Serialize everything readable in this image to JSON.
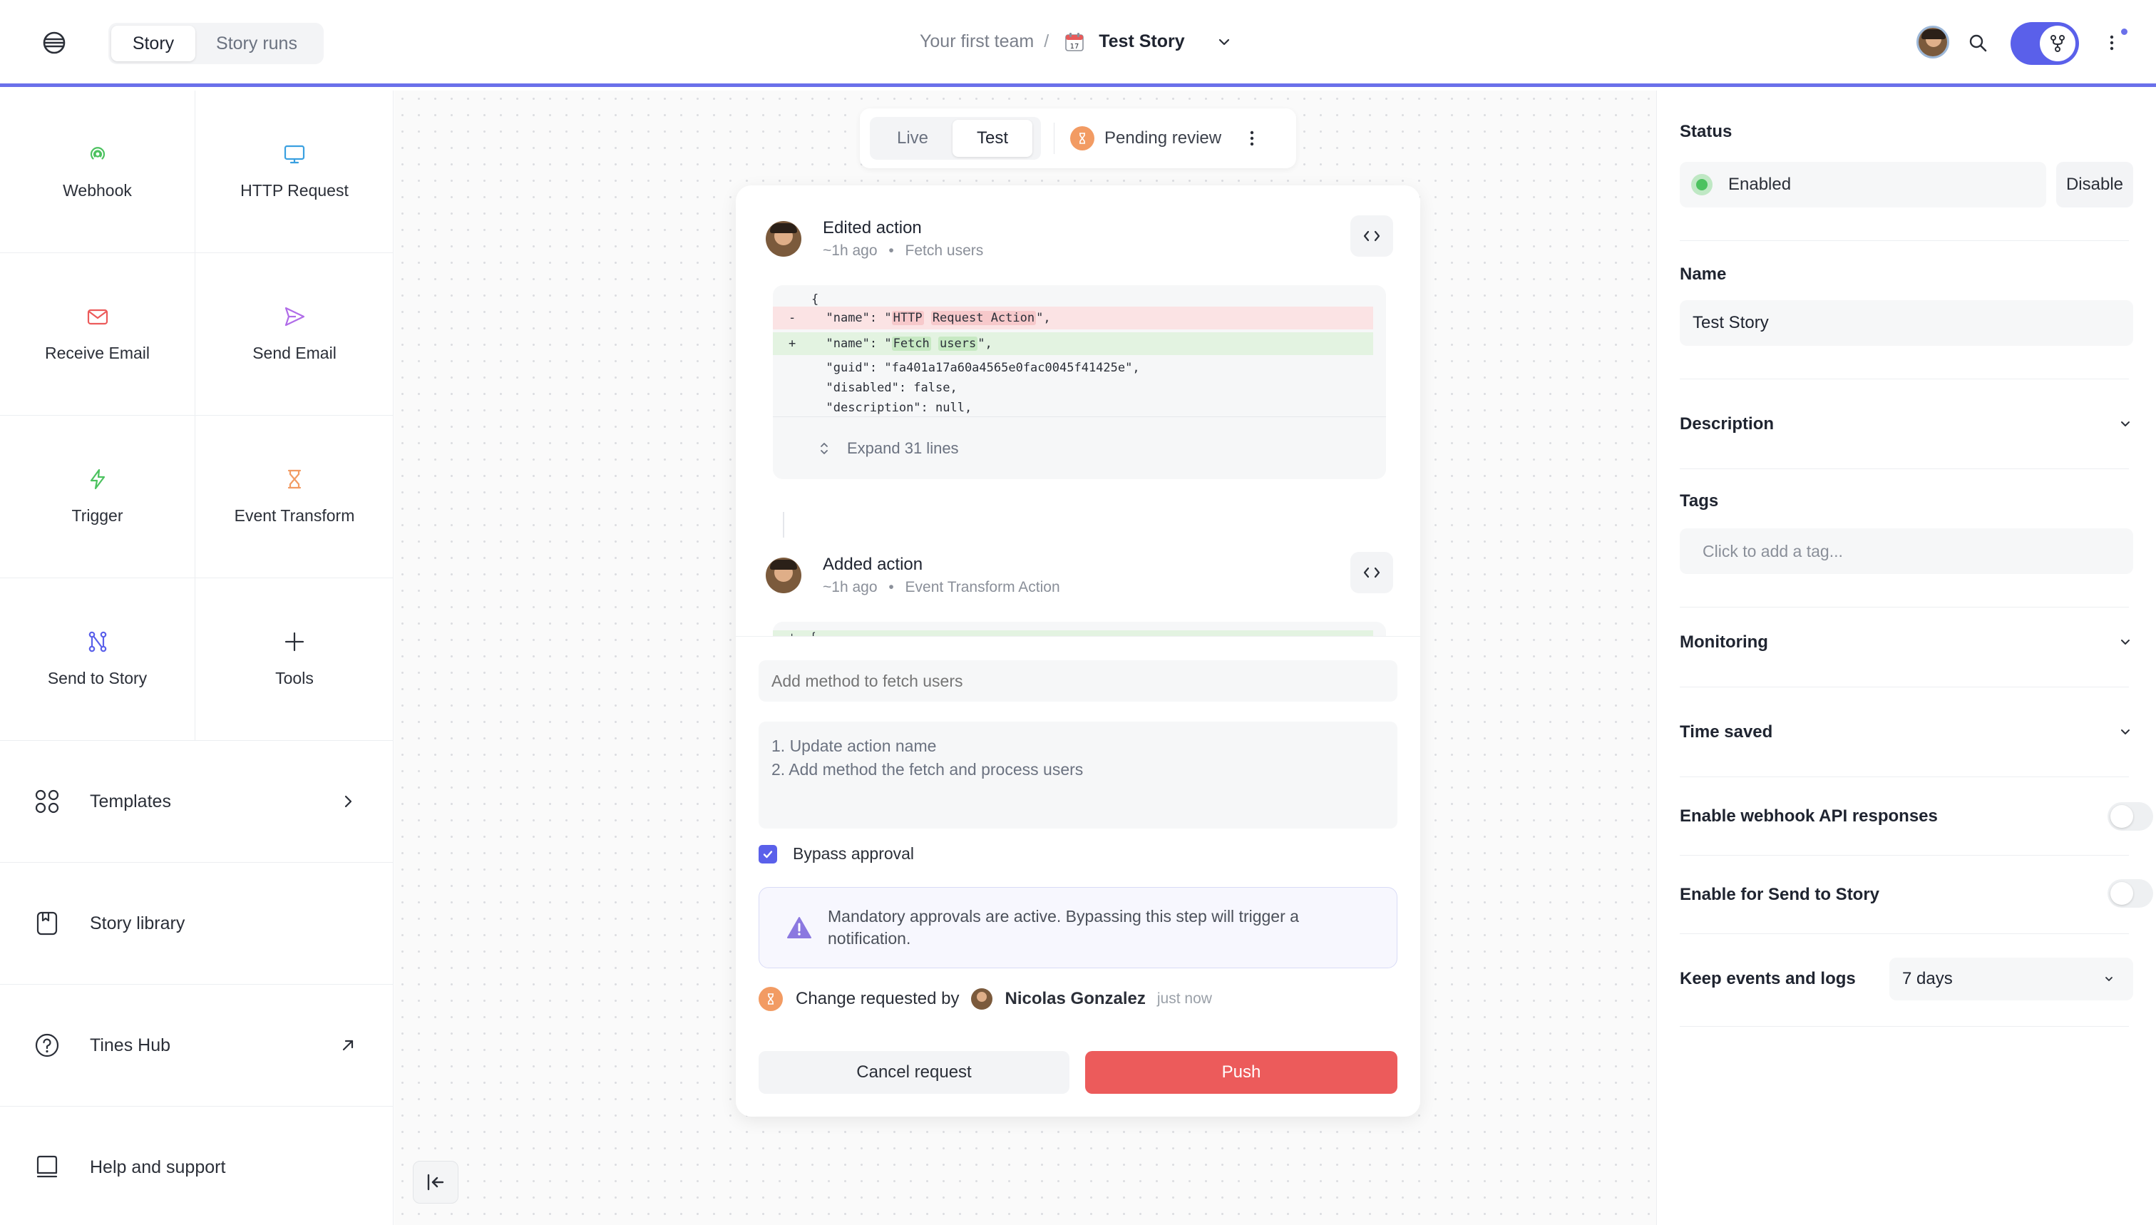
{
  "header": {
    "tabs": [
      {
        "label": "Story",
        "active": true
      },
      {
        "label": "Story runs",
        "active": false
      }
    ],
    "breadcrumb": {
      "team": "Your first team",
      "separator": "/",
      "story": "Test Story"
    },
    "accent_color": "#5a60ea"
  },
  "sidebar": {
    "tools": [
      {
        "label": "Webhook",
        "icon": "webhook-icon",
        "color": "#4cc25f"
      },
      {
        "label": "HTTP Request",
        "icon": "monitor-icon",
        "color": "#3aa0e0"
      },
      {
        "label": "Receive Email",
        "icon": "mail-icon",
        "color": "#ec5b5b"
      },
      {
        "label": "Send Email",
        "icon": "send-icon",
        "color": "#b06ce8"
      },
      {
        "label": "Trigger",
        "icon": "bolt-icon",
        "color": "#4cc25f"
      },
      {
        "label": "Event Transform",
        "icon": "hourglass-icon",
        "color": "#f29b63"
      },
      {
        "label": "Send to Story",
        "icon": "branch-icon",
        "color": "#5a60ea"
      },
      {
        "label": "Tools",
        "icon": "plus-icon",
        "color": "#2b2f38"
      }
    ],
    "nav": [
      {
        "label": "Templates",
        "icon": "grid-icon",
        "trail": "chevron-right-icon"
      },
      {
        "label": "Story library",
        "icon": "book-icon",
        "trail": ""
      },
      {
        "label": "Tines Hub",
        "icon": "help-circle-icon",
        "trail": "arrow-up-right-icon"
      },
      {
        "label": "Help and support",
        "icon": "chat-icon",
        "trail": ""
      }
    ]
  },
  "modebar": {
    "tabs": [
      {
        "label": "Live",
        "active": false
      },
      {
        "label": "Test",
        "active": true
      }
    ],
    "status": "Pending review"
  },
  "changes": [
    {
      "title": "Edited action",
      "time": "~1h ago",
      "sep": "•",
      "target": "Fetch users",
      "diff": {
        "open": "{",
        "removed_sign": "-",
        "removed_prefix": "\"name\": \"",
        "removed_hl": [
          "HTTP",
          "Request Action"
        ],
        "removed_suffix": "\",",
        "added_sign": "+",
        "added_prefix": "\"name\": \"",
        "added_hl": [
          "Fetch",
          "users"
        ],
        "added_suffix": "\",",
        "context": [
          "\"guid\": \"fa401a17a60a4565e0fac0045f41425e\",",
          "\"disabled\": false,",
          "\"description\": null,"
        ],
        "expand_label": "Expand 31 lines"
      }
    },
    {
      "title": "Added action",
      "time": "~1h ago",
      "sep": "•",
      "target": "Event Transform Action",
      "diff": {
        "sign": "+",
        "text": "{"
      }
    }
  ],
  "form": {
    "message_placeholder": "Add method to fetch users",
    "description_lines": [
      "1. Update action name",
      "2. Add method the fetch and process users"
    ],
    "bypass_label": "Bypass approval",
    "bypass_checked": true,
    "warning": "Mandatory approvals are active. Bypassing this step will trigger a notification.",
    "request": {
      "prefix": "Change requested by",
      "user": "Nicolas Gonzalez",
      "time": "just now"
    },
    "cancel_label": "Cancel request",
    "push_label": "Push",
    "push_color": "#ec5b5b"
  },
  "panel": {
    "status_label": "Status",
    "status_value": "Enabled",
    "disable_label": "Disable",
    "name_label": "Name",
    "name_value": "Test Story",
    "description_label": "Description",
    "tags_label": "Tags",
    "tags_placeholder": "Click to add a tag...",
    "monitoring_label": "Monitoring",
    "time_saved_label": "Time saved",
    "webhook_api_label": "Enable webhook API responses",
    "webhook_api_on": false,
    "send_to_story_label": "Enable for Send to Story",
    "send_to_story_on": false,
    "keep_events_label": "Keep events and logs",
    "keep_events_value": "7 days"
  }
}
